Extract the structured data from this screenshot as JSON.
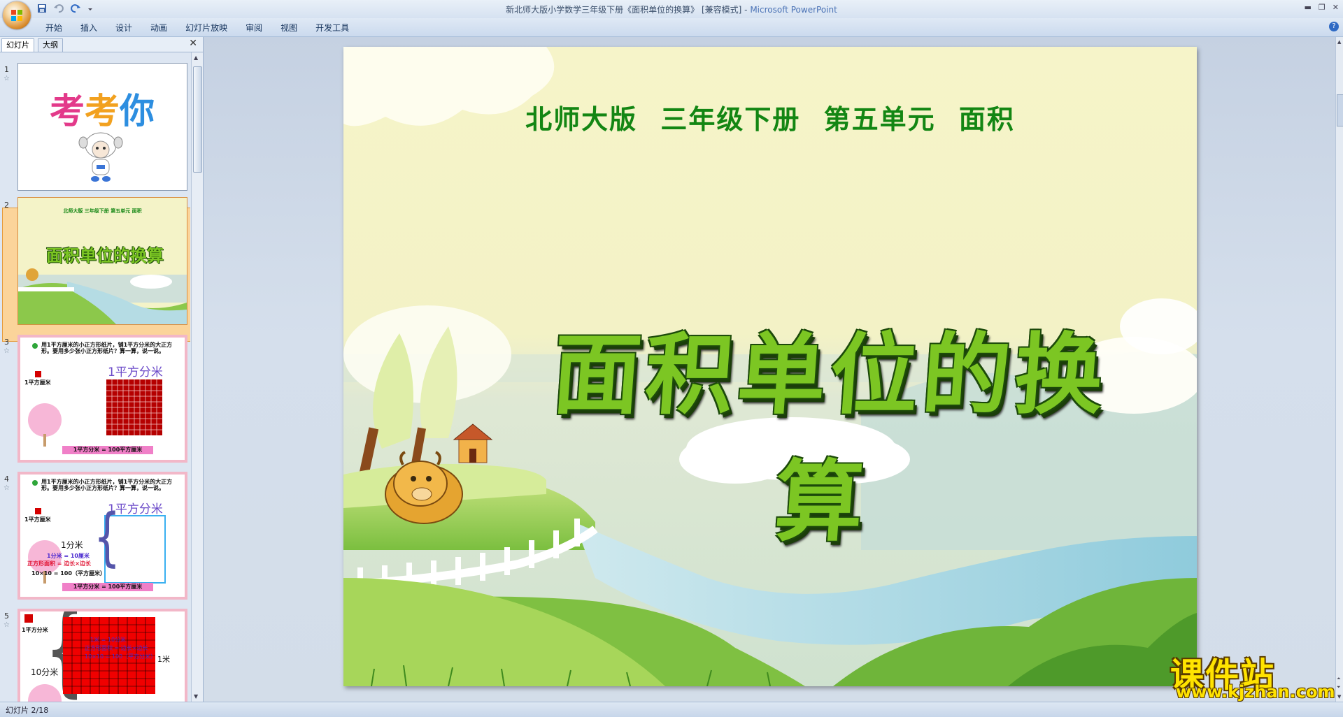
{
  "window": {
    "title": "新北师大版小学数学三年级下册《面积单位的换算》 [兼容模式] - ",
    "app_name": "Microsoft PowerPoint"
  },
  "ribbon": {
    "tabs": [
      "开始",
      "插入",
      "设计",
      "动画",
      "幻灯片放映",
      "审阅",
      "视图",
      "开发工具"
    ]
  },
  "left_pane": {
    "tabs": [
      "幻灯片",
      "大纲"
    ],
    "thumbnails": [
      {
        "num": "1",
        "text": [
          "考",
          "考",
          "你"
        ]
      },
      {
        "num": "2",
        "header": "北师大版  三年级下册  第五单元  面积",
        "title": "面积单位的换算"
      },
      {
        "num": "3",
        "text": "用1平方厘米的小正方形纸片，铺1平方分米的大正方形。要用多少张小正方形纸片？算一算，说一说。",
        "label_big": "1平方分米",
        "label_small": "1平方厘米",
        "footer": "1平方分米 = 100平方厘米"
      },
      {
        "num": "4",
        "text": "用1平方厘米的小正方形纸片，铺1平方分米的大正方形。要用多少张小正方形纸片？算一算，说一说。",
        "label_big": "1平方分米",
        "label_small": "1平方厘米",
        "side": "1分米",
        "eq1": "1分米 = 10厘米",
        "eq2": "正方形面积 = 边长×边长",
        "eq3": "10×10 = 100（平方厘米）",
        "footer": "1平方分米 = 100平方厘米"
      },
      {
        "num": "5",
        "label_small": "1平方分米",
        "side": "10分米",
        "right": "1米",
        "eq1": "1米 = 10分米",
        "eq2": "正方形面积 = 边长×边长",
        "eq3": "10×10 = 100（平方分米）"
      }
    ]
  },
  "slide": {
    "subtitle": "北师大版  三年级下册  第五单元  面积",
    "title": "面积单位的换算"
  },
  "watermark": {
    "text": "课件站",
    "url": "www.kjzhan.com"
  },
  "status": {
    "text": "幻灯片 2/18"
  },
  "colors": {
    "selected_thumb": "#f4a860",
    "title_green": "#7cc623",
    "subtitle_green": "#138613"
  }
}
